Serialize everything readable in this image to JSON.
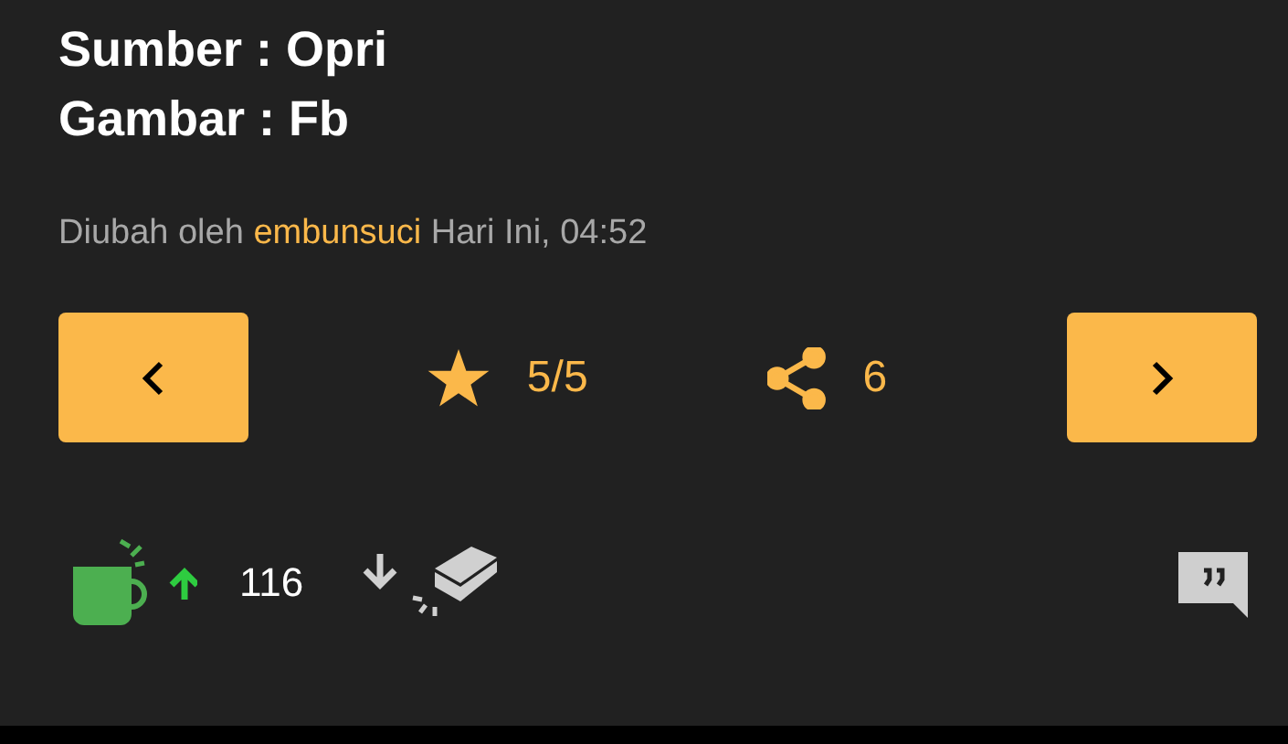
{
  "credits": [
    "Sumber : Opri",
    "Gambar : Fb"
  ],
  "edit_info": {
    "prefix": "Diubah oleh",
    "author": "embunsuci",
    "time": "Hari Ini, 04:52"
  },
  "rating": "5/5",
  "shares": "6",
  "votes": {
    "count": "116"
  }
}
